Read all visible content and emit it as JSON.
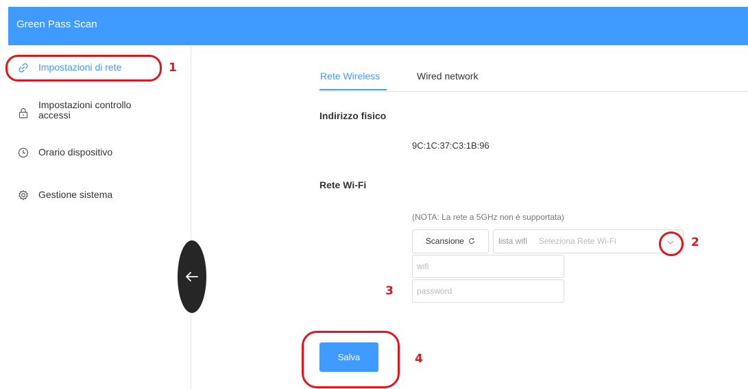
{
  "header": {
    "title": "Green Pass Scan"
  },
  "sidebar": {
    "items": [
      {
        "label": "Impostazioni di rete",
        "icon": "link-icon",
        "active": true
      },
      {
        "label_line1": "Impostazioni controllo",
        "label_line2": "accessi",
        "icon": "lock-icon"
      },
      {
        "label": "Orario dispositivo",
        "icon": "clock-icon"
      },
      {
        "label": "Gestione sistema",
        "icon": "gear-icon"
      }
    ]
  },
  "tabs": [
    {
      "label": "Rete Wireless",
      "active": true
    },
    {
      "label": "Wired network",
      "active": false
    }
  ],
  "content": {
    "mac_title": "Indirizzo fisico",
    "mac_value": "9C:1C:37:C3:1B:96",
    "wifi_title": "Rete Wi-Fi",
    "note": "(NOTA: La rete a 5GHz non è supportata)",
    "scan_label": "Scansione",
    "select_label": "lista wifi",
    "select_placeholder": "Seleziona Rete Wi-Fi",
    "ssid_placeholder": "wifi",
    "password_placeholder": "password",
    "save_label": "Salva"
  },
  "annotations": [
    "1",
    "2",
    "3",
    "4"
  ],
  "colors": {
    "accent": "#3f9bff",
    "annotation": "#e0161c",
    "back_button": "#262626"
  }
}
